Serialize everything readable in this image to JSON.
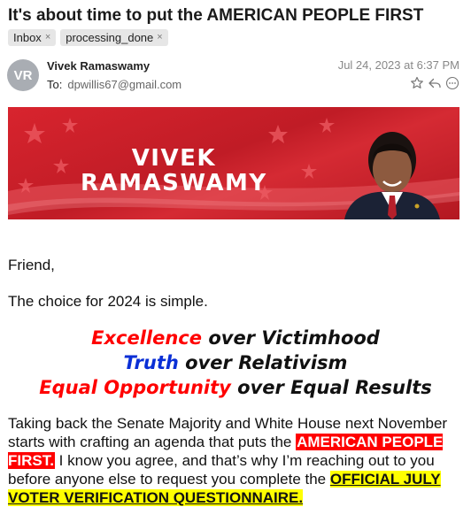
{
  "email": {
    "subject": "It's about time to put the AMERICAN PEOPLE FIRST",
    "tags": [
      {
        "label": "Inbox"
      },
      {
        "label": "processing_done"
      }
    ],
    "sender": {
      "initials": "VR",
      "name": "Vivek Ramaswamy"
    },
    "to_label": "To:",
    "to_address": "dpwillis67@gmail.com",
    "date": "Jul 24, 2023 at 6:37 PM",
    "tag_remove_glyph": "×"
  },
  "banner": {
    "line1": "VIVEK",
    "line2": "RAMASWAMY",
    "bg_color": "#d8242e"
  },
  "body": {
    "greeting": "Friend,",
    "intro": "The choice for 2024 is simple.",
    "taglines": [
      {
        "highlight": "Excellence",
        "rest": " over Victimhood",
        "color": "#ff0000"
      },
      {
        "highlight": "Truth",
        "rest": " over Relativism",
        "color": "#0a2fd6"
      },
      {
        "highlight": "Equal Opportunity",
        "rest": " over Equal Results",
        "color": "#ff0000"
      }
    ],
    "paragraph_part1": "Taking back the Senate Majority and White House next November starts with crafting an agenda that puts the ",
    "paragraph_highlight": "AMERICAN PEOPLE FIRST.",
    "paragraph_part2": " I know you agree, and that’s why I’m reaching out to you before anyone else to request you complete the ",
    "paragraph_link": "OFFICIAL JULY VOTER VERIFICATION QUESTIONNAIRE."
  },
  "icons": {
    "star": "star-icon",
    "reply": "reply-icon",
    "more": "more-icon"
  }
}
